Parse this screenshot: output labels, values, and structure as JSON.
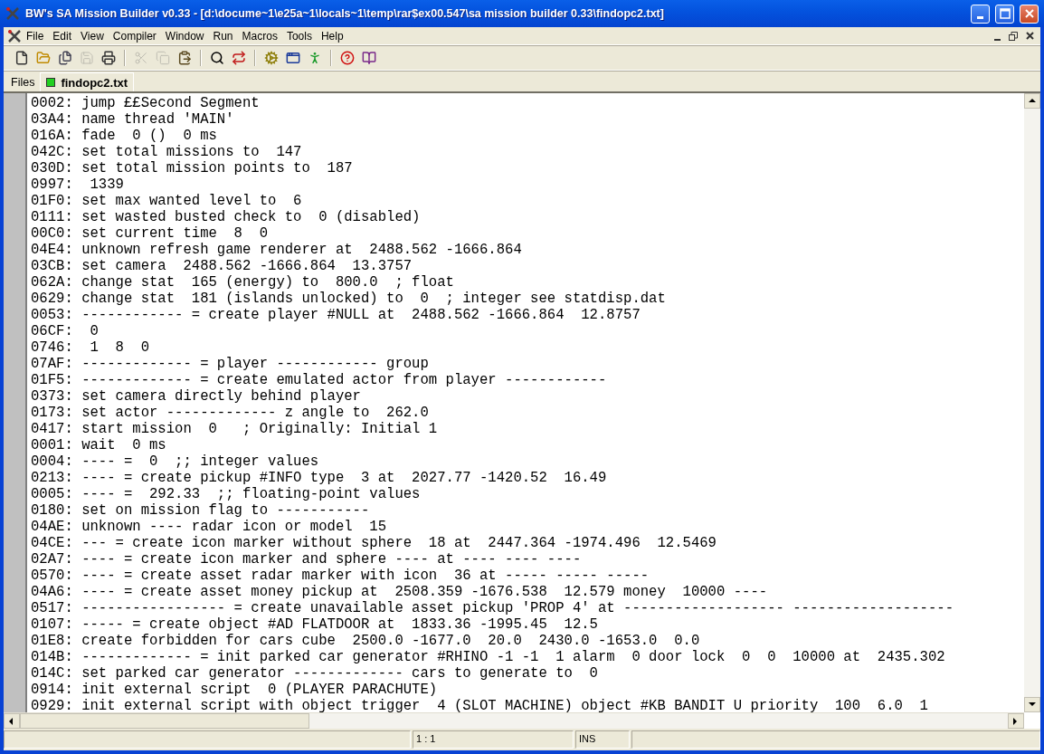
{
  "window": {
    "title": "BW's SA Mission Builder v0.33 - [d:\\docume~1\\e25a~1\\locals~1\\temp\\rar$ex00.547\\sa mission builder 0.33\\findopc2.txt]"
  },
  "menu": [
    "File",
    "Edit",
    "View",
    "Compiler",
    "Window",
    "Run",
    "Macros",
    "Tools",
    "Help"
  ],
  "toolbar": [
    {
      "kind": "new",
      "disabled": false
    },
    {
      "kind": "open",
      "disabled": false
    },
    {
      "kind": "open-all",
      "disabled": false
    },
    {
      "kind": "save",
      "disabled": true
    },
    {
      "kind": "print",
      "disabled": false
    },
    {
      "kind": "separator"
    },
    {
      "kind": "cut",
      "disabled": true
    },
    {
      "kind": "copy",
      "disabled": true
    },
    {
      "kind": "paste",
      "disabled": false
    },
    {
      "kind": "separator"
    },
    {
      "kind": "find",
      "disabled": false
    },
    {
      "kind": "replace",
      "disabled": false
    },
    {
      "kind": "separator"
    },
    {
      "kind": "compile",
      "disabled": false
    },
    {
      "kind": "windows",
      "disabled": false
    },
    {
      "kind": "run",
      "disabled": false
    },
    {
      "kind": "separator"
    },
    {
      "kind": "help",
      "disabled": false
    },
    {
      "kind": "book",
      "disabled": false
    }
  ],
  "files_label": "Files",
  "tabs": [
    {
      "label": "findopc2.txt",
      "selected": true
    }
  ],
  "lines": [
    "0002: jump ££Second Segment",
    "03A4: name thread 'MAIN'",
    "016A: fade  0 ()  0 ms",
    "042C: set total missions to  147",
    "030D: set total mission points to  187",
    "0997:  1339",
    "01F0: set max wanted level to  6",
    "0111: set wasted busted check to  0 (disabled)",
    "00C0: set current time  8  0",
    "04E4: unknown refresh game renderer at  2488.562 -1666.864",
    "03CB: set camera  2488.562 -1666.864  13.3757",
    "062A: change stat  165 (energy) to  800.0  ; float",
    "0629: change stat  181 (islands unlocked) to  0  ; integer see statdisp.dat",
    "0053: ------------ = create player #NULL at  2488.562 -1666.864  12.8757",
    "06CF:  0",
    "0746:  1  8  0",
    "07AF: ------------- = player ------------ group",
    "01F5: ------------- = create emulated actor from player ------------",
    "0373: set camera directly behind player",
    "0173: set actor ------------- z angle to  262.0",
    "0417: start mission  0   ; Originally: Initial 1",
    "0001: wait  0 ms",
    "0004: ---- =  0  ;; integer values",
    "0213: ---- = create pickup #INFO type  3 at  2027.77 -1420.52  16.49",
    "0005: ---- =  292.33  ;; floating-point values",
    "0180: set on mission flag to -----------",
    "04AE: unknown ---- radar icon or model  15",
    "04CE: --- = create icon marker without sphere  18 at  2447.364 -1974.496  12.5469",
    "02A7: ---- = create icon marker and sphere ---- at ---- ---- ----",
    "0570: ---- = create asset radar marker with icon  36 at ----- ----- -----",
    "04A6: ---- = create asset money pickup at  2508.359 -1676.538  12.579 money  10000 ----",
    "0517: ----------------- = create unavailable asset pickup 'PROP 4' at ------------------- -------------------",
    "0107: ----- = create object #AD FLATDOOR at  1833.36 -1995.45  12.5",
    "01E8: create forbidden for cars cube  2500.0 -1677.0  20.0  2430.0 -1653.0  0.0",
    "014B: ------------- = init parked car generator #RHINO -1 -1  1 alarm  0 door lock  0  0  10000 at  2435.302",
    "014C: set parked car generator ------------- cars to generate to  0",
    "0914: init external script  0 (PLAYER PARACHUTE)",
    "0929: init external script with object trigger  4 (SLOT MACHINE) object #KB BANDIT U priority  100  6.0  1"
  ],
  "status_bar": [
    "1 : 1",
    "INS"
  ]
}
